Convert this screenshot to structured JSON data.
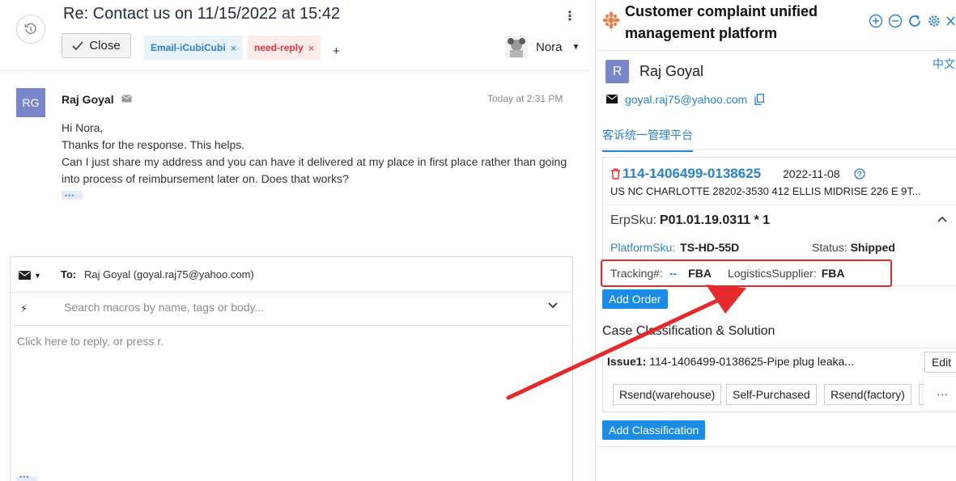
{
  "ticket": {
    "title": "Re: Contact us  on 11/15/2022 at 15:42",
    "close_label": "Close",
    "tags": [
      {
        "label": "Email-iCubiCubi",
        "remove": "×"
      },
      {
        "label": "need-reply",
        "remove": "×"
      }
    ],
    "add_tag_label": "+",
    "menu_label": "⋮",
    "assignee": "Nora"
  },
  "message": {
    "avatar_initials": "RG",
    "sender": "Raj Goyal",
    "time": "Today at 2:31 PM",
    "lines": [
      "Hi Nora,",
      "Thanks for the response. This helps.",
      "Can I just share my address and you can have it delivered at my place in first place rather than going into process of reimbursement later on. Does that works?"
    ]
  },
  "reply": {
    "to_label": "To:",
    "to_value": "Raj Goyal (goyal.raj75@yahoo.com)",
    "macro_placeholder": "Search macros by name, tags or body...",
    "reply_placeholder": "Click here to reply, or press r."
  },
  "panel": {
    "title": "Customer complaint unified management platform",
    "language": "中文",
    "customer": {
      "initial": "R",
      "name": "Raj Goyal",
      "email": "goyal.raj75@yahoo.com"
    },
    "tab": "客诉统一管理平台",
    "order": {
      "id": "114-1406499-0138625",
      "date": "2022-11-08",
      "address": "US NC CHARLOTTE 28202-3530 412 ELLIS MIDRISE 226 E 9T...",
      "erp_label": "ErpSku:",
      "erp_value": "P01.01.19.0311 * 1",
      "platform_sku_label": "PlatformSku:",
      "platform_sku_value": "TS-HD-55D",
      "status_label": "Status:",
      "status_value": "Shipped",
      "tracking_label": "Tracking#:",
      "tracking_value": "--",
      "tracking_carrier": "FBA",
      "logistics_label": "LogisticsSupplier:",
      "logistics_value": "FBA"
    },
    "add_order_label": "Add Order",
    "section_title": "Case Classification & Solution",
    "issue": {
      "label": "Issue1:",
      "value": "114-1406499-0138625-Pipe plug leaka...",
      "edit_label": "Edit",
      "solutions": [
        "Rsend(warehouse)",
        "Self-Purchased",
        "Rsend(factory)"
      ],
      "more_label": "···"
    },
    "add_classification_label": "Add Classification"
  },
  "colors": {
    "accent": "#2a82c8",
    "button_blue": "#1a8ce6",
    "annotation_red": "#e42a2a",
    "avatar": "#7a86cc"
  }
}
